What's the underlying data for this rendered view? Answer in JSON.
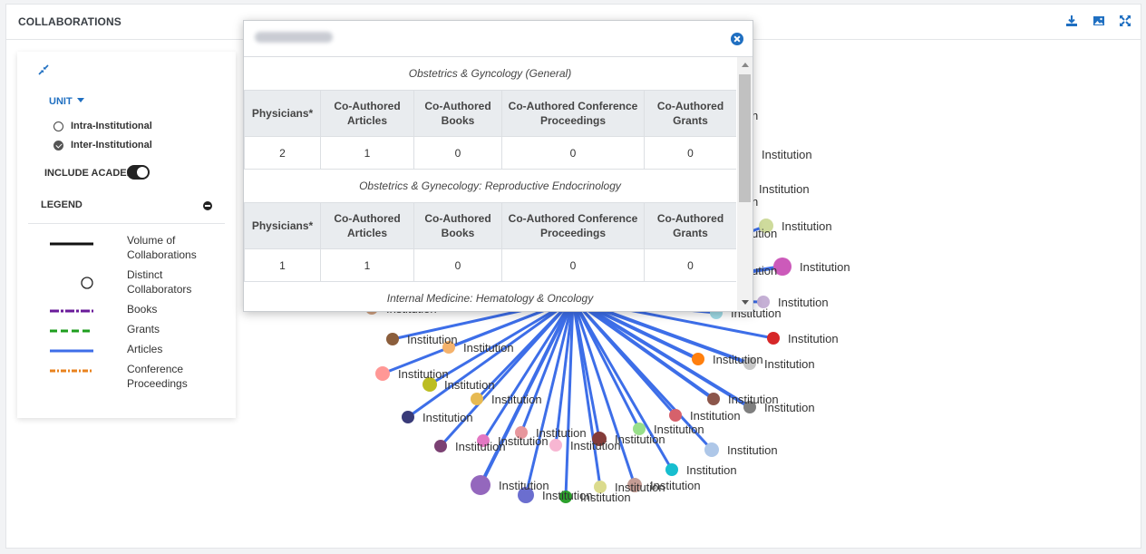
{
  "header": {
    "title": "COLLABORATIONS",
    "actions": [
      "download-icon",
      "image-icon",
      "expand-icon"
    ],
    "accent_color": "#1f6fc1"
  },
  "panel": {
    "unit_label": "UNIT",
    "unit_options": [
      {
        "label": "Intra-Institutional",
        "selected": false
      },
      {
        "label": "Inter-Institutional",
        "selected": true
      }
    ],
    "include_academic_label": "INCLUDE ACADEMIC",
    "include_academic_on": true,
    "legend_title": "LEGEND",
    "legend": [
      {
        "symbol": "thick-solid-line",
        "color": "#111111",
        "label": "Volume of Collaborations"
      },
      {
        "symbol": "circle",
        "color": "#333333",
        "label": "Distinct Collaborators"
      },
      {
        "symbol": "dash-dot-line",
        "color": "#6a1b9a",
        "label": "Books"
      },
      {
        "symbol": "dashed-line",
        "color": "#1e9e1e",
        "label": "Grants"
      },
      {
        "symbol": "solid-line",
        "color": "#3d6ee8",
        "label": "Articles"
      },
      {
        "symbol": "dash-dot-line",
        "color": "#e8821e",
        "label": "Conference Proceedings"
      }
    ]
  },
  "popup": {
    "columns": [
      "Physicians*",
      "Co-Authored Articles",
      "Co-Authored Books",
      "Co-Authored Conference Proceedings",
      "Co-Authored Grants"
    ],
    "sections": [
      {
        "specialty": "Obstetrics & Gyncology (General)",
        "row": [
          "2",
          "1",
          "0",
          "0",
          "0"
        ]
      },
      {
        "specialty": "Obstetrics & Gynecology: Reproductive Endocrinology",
        "row": [
          "1",
          "1",
          "0",
          "0",
          "0"
        ]
      },
      {
        "specialty": "Internal Medicine: Hematology & Oncology",
        "row": []
      }
    ]
  },
  "network": {
    "edge_color": "#3d6ee8",
    "node_label": "Institution",
    "hidden_partial_labels": [
      "n",
      "n",
      "ution",
      "ution"
    ],
    "node_colors": [
      "#8b5e3c",
      "#f5b26b",
      "#ff9896",
      "#bcbd22",
      "#e7ba52",
      "#393b79",
      "#7b4173",
      "#e377c2",
      "#f7b6d2",
      "#e7969c",
      "#843c39",
      "#98df8a",
      "#d6616b",
      "#8c564b",
      "#7f7f7f",
      "#aec7e8",
      "#17becf",
      "#c49c94",
      "#dbdb8d",
      "#2ca02c",
      "#6b6ecf",
      "#9467bd",
      "#ff7f0e",
      "#d62728",
      "#c5b0d5",
      "#c7c7c7",
      "#9edae5",
      "#cc5aba",
      "#cedb9c",
      "#d0a080"
    ]
  }
}
